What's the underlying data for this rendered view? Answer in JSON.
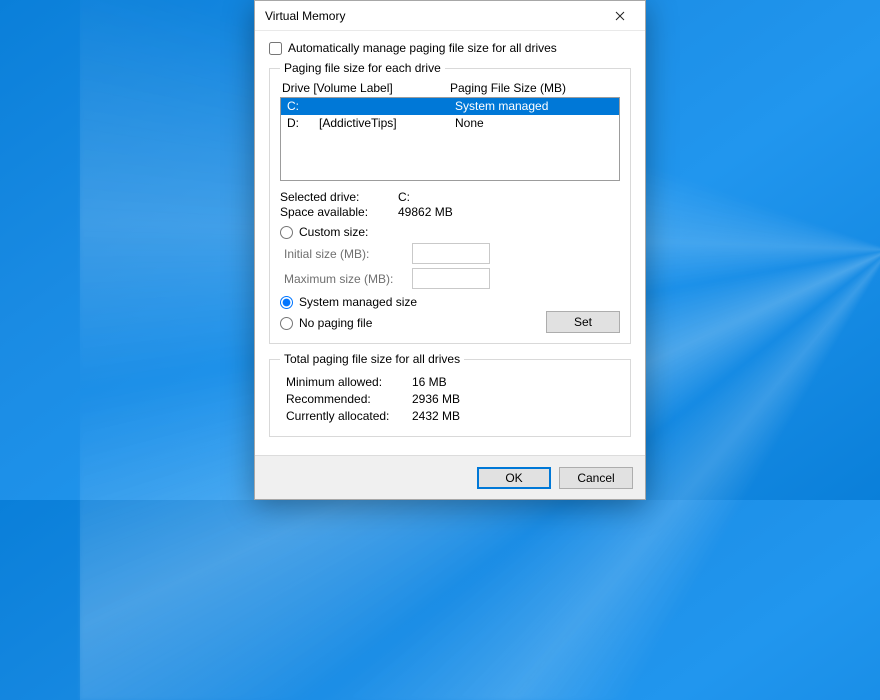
{
  "window": {
    "title": "Virtual Memory",
    "close_tooltip": "Close"
  },
  "auto_manage": {
    "label": "Automatically manage paging file size for all drives",
    "checked": false
  },
  "drives_group": {
    "legend": "Paging file size for each drive",
    "header_drive": "Drive  [Volume Label]",
    "header_size": "Paging File Size (MB)",
    "rows": [
      {
        "drive": "C:",
        "label": "",
        "size": "System managed",
        "selected": true
      },
      {
        "drive": "D:",
        "label": "[AddictiveTips]",
        "size": "None",
        "selected": false
      }
    ],
    "selected_drive_label": "Selected drive:",
    "selected_drive_value": "C:",
    "space_avail_label": "Space available:",
    "space_avail_value": "49862 MB",
    "custom_size_label": "Custom size:",
    "initial_label": "Initial size (MB):",
    "initial_value": "",
    "maximum_label": "Maximum size (MB):",
    "maximum_value": "",
    "system_managed_label": "System managed size",
    "no_paging_label": "No paging file",
    "size_choice": "system",
    "set_button": "Set"
  },
  "totals_group": {
    "legend": "Total paging file size for all drives",
    "min_label": "Minimum allowed:",
    "min_value": "16 MB",
    "rec_label": "Recommended:",
    "rec_value": "2936 MB",
    "cur_label": "Currently allocated:",
    "cur_value": "2432 MB"
  },
  "footer": {
    "ok": "OK",
    "cancel": "Cancel"
  }
}
